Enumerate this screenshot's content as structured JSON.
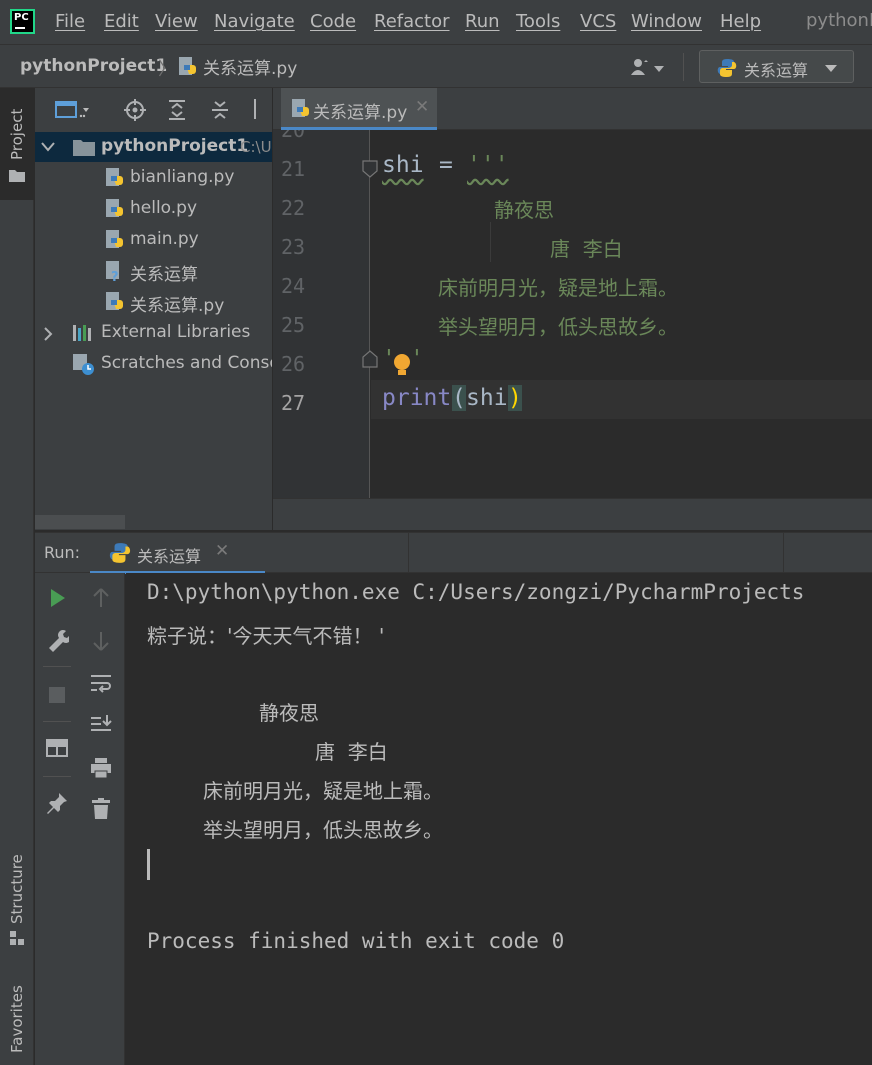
{
  "app": {
    "logo_text": "PC",
    "window_title": "pythonP"
  },
  "menu": [
    "File",
    "Edit",
    "View",
    "Navigate",
    "Code",
    "Refactor",
    "Run",
    "Tools",
    "VCS",
    "Window",
    "Help"
  ],
  "navbar": {
    "project": "pythonProject1",
    "separator": "〉",
    "file": "关系运算.py",
    "run_config": "关系运算"
  },
  "left_strip": {
    "project_tab": "Project",
    "structure_tab": "Structure",
    "favorites_tab": "Favorites"
  },
  "project_tree": {
    "root": {
      "name": "pythonProject1",
      "path": "C:\\U"
    },
    "files": [
      "bianliang.py",
      "hello.py",
      "main.py",
      "关系运算",
      "关系运算.py"
    ],
    "external": "External Libraries",
    "scratches": "Scratches and Consol"
  },
  "editor": {
    "tab": "关系运算.py",
    "partial_line_number": "20",
    "line_numbers": [
      "21",
      "22",
      "23",
      "24",
      "25",
      "26",
      "27"
    ],
    "line21": {
      "var": "shi",
      "op": "=",
      "str": "'''"
    },
    "line22": "静夜思",
    "line23": "唐  李白",
    "line24": "床前明月光，疑是地上霜。",
    "line25": "举头望明月，低头思故乡。",
    "line26": {
      "q1": "'",
      "q2": "'"
    },
    "line27": {
      "fn": "print",
      "lp": "(",
      "arg": "shi",
      "rp": ")"
    }
  },
  "run": {
    "label": "Run:",
    "tab": "关系运算",
    "console": {
      "cmd": "D:\\python\\python.exe C:/Users/zongzi/PycharmProjects",
      "line2": "粽子说：'今天天气不错！ '",
      "poem_title": "静夜思",
      "poem_author": "唐  李白",
      "poem_1": "床前明月光，疑是地上霜。",
      "poem_2": "举头望明月，低头思故乡。",
      "finished": "Process finished with exit code 0"
    }
  },
  "colors": {
    "keyword_fn": "#8888c6",
    "string": "#6a8759",
    "default": "#a9b7c6",
    "accent": "#4a88c7",
    "run_green": "#499c54"
  }
}
